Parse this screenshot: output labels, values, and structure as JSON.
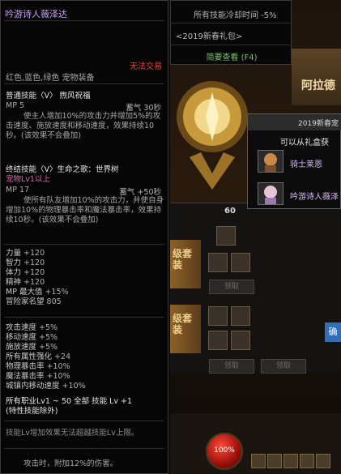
{
  "tooltip": {
    "title": "吟游诗人薇泽达",
    "trade": "无法交易",
    "equip": "红色,蓝色,绿色 宠物装备",
    "skill1": {
      "name": "普通技能〈V〉 煦风祝福",
      "mp": "MP 5",
      "cost": "蓄气 30秒",
      "desc": "使主人增加10%的攻击力并增加5%的攻击速度、施放速度和移动速度，效果持续10秒。(该效果不会叠加)"
    },
    "skill2": {
      "name": "终结技能〈V〉生命之歌：世界树",
      "req": "宠物Lv1以上",
      "mp": "MP 17",
      "cost": "蓄气 +50秒",
      "desc": "使所有队友增加10%的攻击力，并使自身增加10%的物理暴击率和魔法暴击率，效果持续10秒。(该效果不会叠加)"
    },
    "stats1": [
      {
        "label": "力量",
        "value": "+120"
      },
      {
        "label": "智力",
        "value": "+120"
      },
      {
        "label": "体力",
        "value": "+120"
      },
      {
        "label": "精神",
        "value": "+120"
      },
      {
        "label": "MP 最大值",
        "value": "+15%"
      },
      {
        "label": "冒险家名望",
        "value": "805"
      }
    ],
    "stats2": [
      {
        "label": "攻击速度",
        "value": "+5%"
      },
      {
        "label": "移动速度",
        "value": "+5%"
      },
      {
        "label": "施放速度",
        "value": "+5%"
      },
      {
        "label": "所有属性强化",
        "value": "+24"
      },
      {
        "label": "物理暴击率",
        "value": "+10%"
      },
      {
        "label": "魔法暴击率",
        "value": "+10%"
      },
      {
        "label": "城镇内移动速度",
        "value": "+10%"
      }
    ],
    "skill_bonus": "所有职业Lv1 ~ 50 全部 技能 Lv +1",
    "skill_bonus_note": "(特性技能除外)",
    "limit_note": "技能Lv增加效果无法超越技能Lv上限。",
    "footer": "攻击时，附加12%的伤害。"
  },
  "right_tip": {
    "cooldown": "所有技能冷却时间 -5%",
    "package": "<2019新春礼包>",
    "summary": "简要查看 (F4)"
  },
  "banner": {
    "text": "阿拉德"
  },
  "popup": {
    "header": "2019新春宠",
    "message": "可以从礼盒获",
    "items": [
      {
        "name": "骑士莱恩",
        "icon": "knight-pet-icon"
      },
      {
        "name": "吟游诗人薇泽",
        "icon": "bard-pet-icon"
      }
    ]
  },
  "panel": {
    "level": "60",
    "card_label": "级套装",
    "card_label2": "级套装",
    "claim": "领取",
    "confirm": "确"
  },
  "hud": {
    "hp": "100%"
  },
  "colors": {
    "title": "#c7a3f5",
    "trade": "#e1483c",
    "summary": "#7bc46b"
  }
}
